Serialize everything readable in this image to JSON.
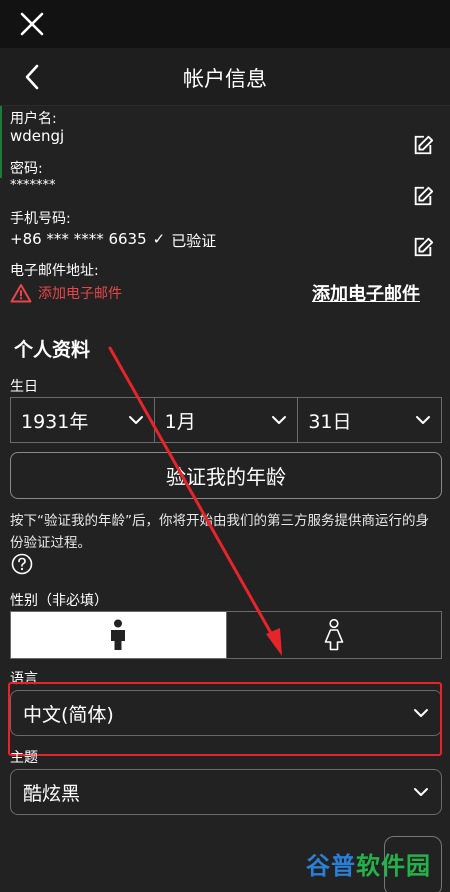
{
  "header": {
    "title": "帐户信息"
  },
  "account": {
    "username_label": "用户名:",
    "username": "wdengj",
    "password_label": "密码:",
    "password": "*******",
    "phone_label": "手机号码:",
    "phone": "+86 *** **** 6635",
    "verified_mark": "✓",
    "verified": "已验证",
    "email_label": "电子邮件地址:",
    "email_warning": "添加电子邮件",
    "add_email_link": "添加电子邮件"
  },
  "profile": {
    "section_title": "个人资料",
    "birthday_label": "生日",
    "year": "1931年",
    "month": "1月",
    "day": "31日",
    "verify_button": "验证我的年龄",
    "verify_note": "按下“验证我的年龄”后，你将开始由我们的第三方服务提供商运行的身份验证过程。",
    "gender_label": "性别（非必填）",
    "gender_selected": "male",
    "language_label": "语言",
    "language_value": "中文(简体)",
    "theme_label": "主题",
    "theme_value": "酷炫黑"
  },
  "watermark": {
    "part1": "谷普",
    "part2": "软件园"
  },
  "colors": {
    "accent_red": "#e8242a",
    "warn_red": "#e8454a",
    "bg": "#222222"
  },
  "icons": [
    "close-icon",
    "back-icon",
    "edit-icon",
    "warning-icon",
    "chevron-down-icon",
    "help-icon",
    "male-icon",
    "female-icon"
  ]
}
